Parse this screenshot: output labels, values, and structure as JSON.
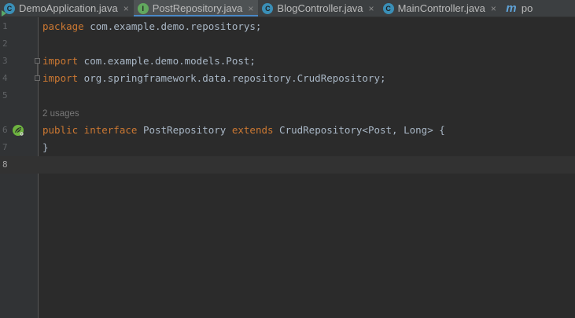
{
  "tabs": [
    {
      "label": "DemoApplication.java",
      "icon": "java-class-run-icon",
      "active": false,
      "close": "×"
    },
    {
      "label": "PostRepository.java",
      "icon": "java-interface-icon",
      "icon_glyph": "I",
      "active": true,
      "close": "×"
    },
    {
      "label": "BlogController.java",
      "icon": "java-class-icon",
      "icon_glyph": "C",
      "active": false,
      "close": "×"
    },
    {
      "label": "MainController.java",
      "icon": "java-class-icon",
      "icon_glyph": "C",
      "active": false,
      "close": "×"
    },
    {
      "label": "po",
      "icon": "maven-pom-icon",
      "icon_glyph": "m",
      "active": false
    }
  ],
  "gutter": {
    "line_numbers": [
      "1",
      "2",
      "3",
      "4",
      "5",
      "6",
      "7",
      "8"
    ],
    "current_line": "8",
    "bean_icon": "spring-bean-icon"
  },
  "editor": {
    "usages_hint": "2 usages",
    "lines": [
      {
        "kw": "package",
        "rest": " com.example.demo.repositorys;"
      },
      {
        "kw": "",
        "rest": ""
      },
      {
        "kw": "import",
        "rest": " com.example.demo.models.Post;"
      },
      {
        "kw": "import",
        "rest": " org.springframework.data.repository.CrudRepository;"
      },
      {
        "kw": "",
        "rest": ""
      },
      {
        "kw": "public interface",
        "mid": " PostRepository ",
        "kw2": "extends",
        "rest": " CrudRepository<Post, Long> {"
      },
      {
        "kw": "",
        "rest": "}"
      },
      {
        "kw": "",
        "rest": ""
      }
    ]
  },
  "colors": {
    "keyword": "#cc7832",
    "text": "#a9b7c6",
    "background": "#2b2b2b",
    "gutter": "#313335",
    "active_tab_underline": "#4a88c7"
  }
}
